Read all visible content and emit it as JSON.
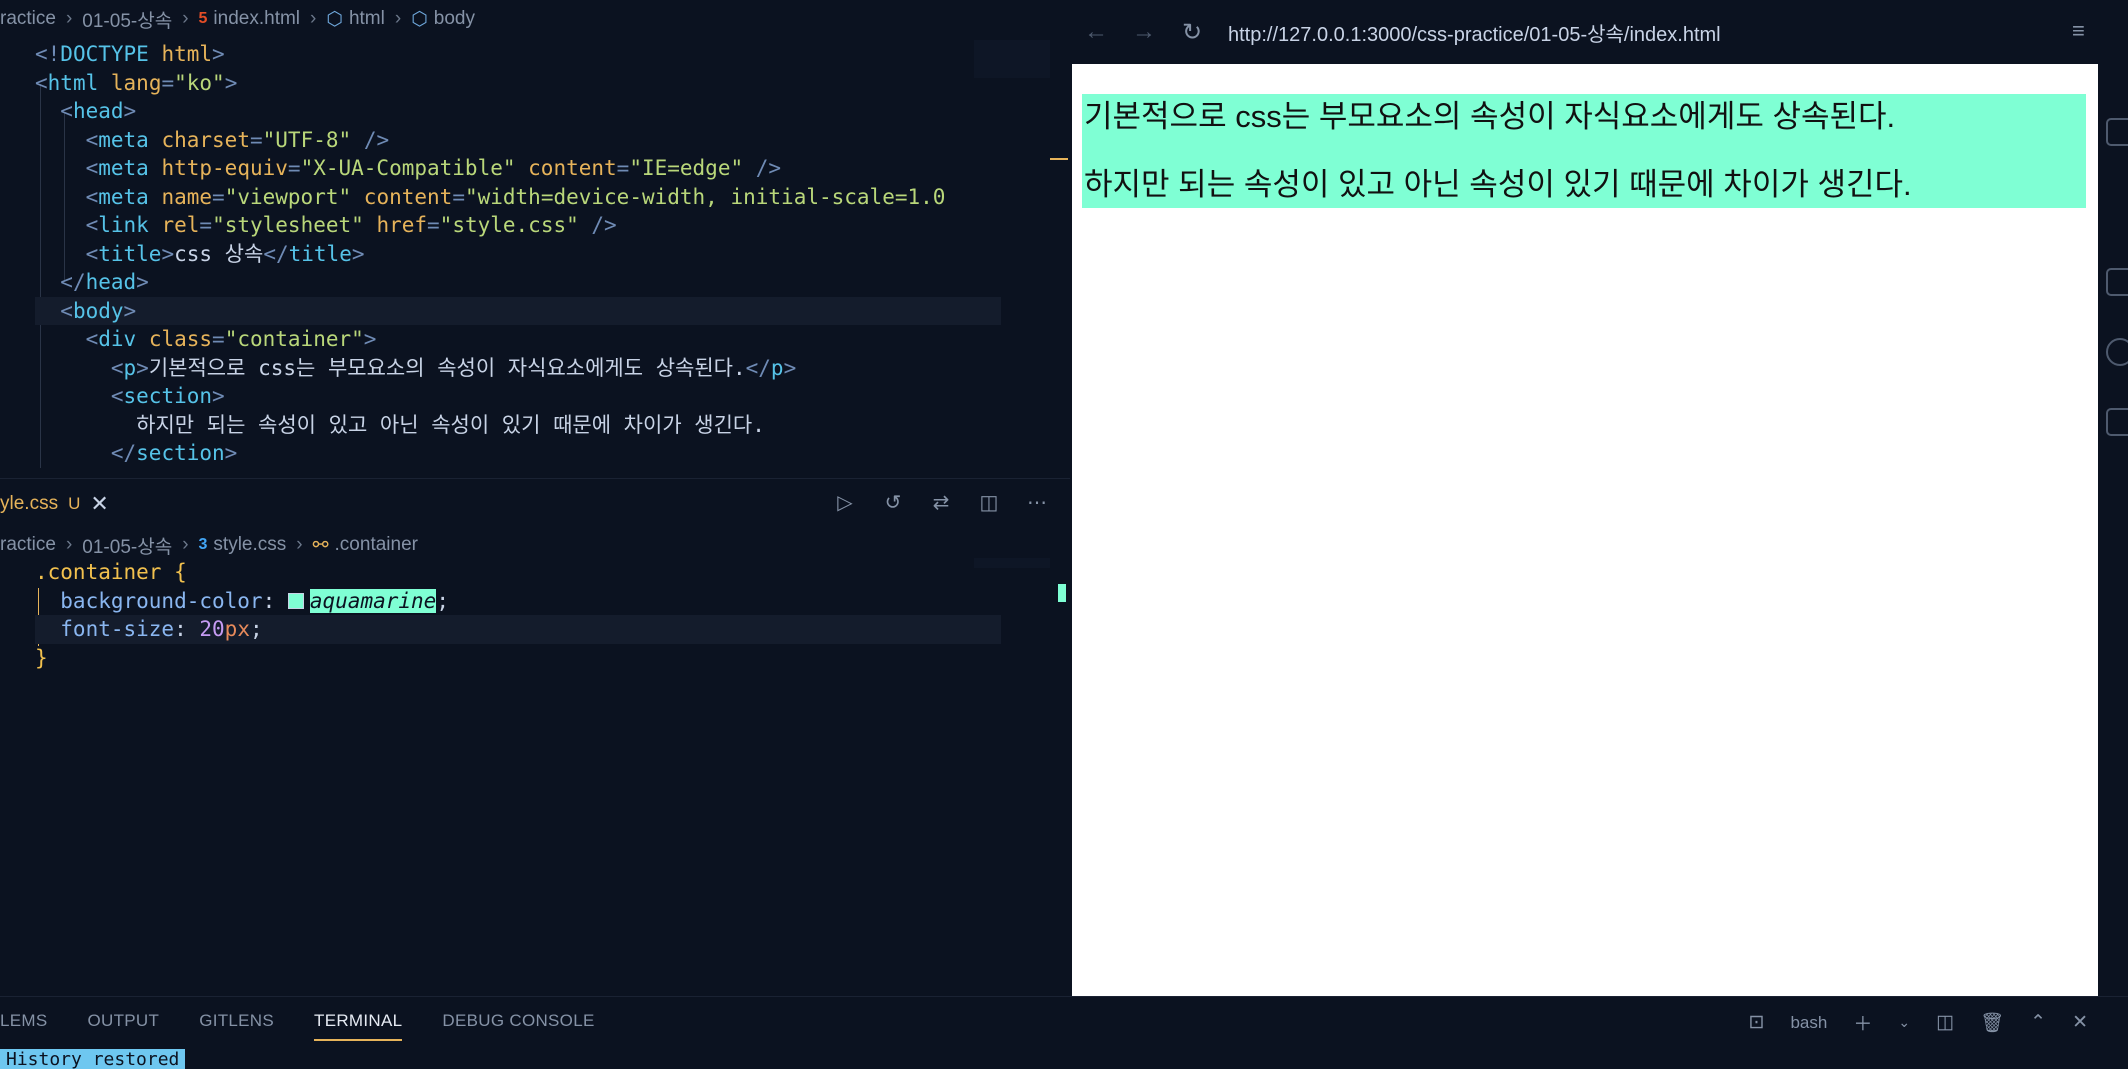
{
  "top_editor": {
    "breadcrumb": [
      "ractice",
      "01-05-상속",
      "index.html",
      "html",
      "body"
    ],
    "lines": [
      [
        [
          "t-punc",
          "<!"
        ],
        [
          "t-tag",
          "DOCTYPE"
        ],
        [
          "t-txt",
          " "
        ],
        [
          "t-attr",
          "html"
        ],
        [
          "t-punc",
          ">"
        ]
      ],
      [
        [
          "t-punc",
          "<"
        ],
        [
          "t-tag",
          "html"
        ],
        [
          "t-txt",
          " "
        ],
        [
          "t-attr",
          "lang"
        ],
        [
          "t-punc",
          "="
        ],
        [
          "t-str",
          "\"ko\""
        ],
        [
          "t-punc",
          ">"
        ]
      ],
      [
        [
          "t-txt",
          "  "
        ],
        [
          "t-punc",
          "<"
        ],
        [
          "t-tag",
          "head"
        ],
        [
          "t-punc",
          ">"
        ]
      ],
      [
        [
          "t-txt",
          "    "
        ],
        [
          "t-punc",
          "<"
        ],
        [
          "t-tag",
          "meta"
        ],
        [
          "t-txt",
          " "
        ],
        [
          "t-attr",
          "charset"
        ],
        [
          "t-punc",
          "="
        ],
        [
          "t-str",
          "\"UTF-8\""
        ],
        [
          "t-txt",
          " "
        ],
        [
          "t-punc",
          "/>"
        ]
      ],
      [
        [
          "t-txt",
          "    "
        ],
        [
          "t-punc",
          "<"
        ],
        [
          "t-tag",
          "meta"
        ],
        [
          "t-txt",
          " "
        ],
        [
          "t-attr",
          "http-equiv"
        ],
        [
          "t-punc",
          "="
        ],
        [
          "t-str",
          "\"X-UA-Compatible\""
        ],
        [
          "t-txt",
          " "
        ],
        [
          "t-attr",
          "content"
        ],
        [
          "t-punc",
          "="
        ],
        [
          "t-str",
          "\"IE=edge\""
        ],
        [
          "t-txt",
          " "
        ],
        [
          "t-punc",
          "/>"
        ]
      ],
      [
        [
          "t-txt",
          "    "
        ],
        [
          "t-punc",
          "<"
        ],
        [
          "t-tag",
          "meta"
        ],
        [
          "t-txt",
          " "
        ],
        [
          "t-attr",
          "name"
        ],
        [
          "t-punc",
          "="
        ],
        [
          "t-str",
          "\"viewport\""
        ],
        [
          "t-txt",
          " "
        ],
        [
          "t-attr",
          "content"
        ],
        [
          "t-punc",
          "="
        ],
        [
          "t-str",
          "\"width=device-width, initial-scale=1.0"
        ]
      ],
      [
        [
          "t-txt",
          "    "
        ],
        [
          "t-punc",
          "<"
        ],
        [
          "t-tag",
          "link"
        ],
        [
          "t-txt",
          " "
        ],
        [
          "t-attr",
          "rel"
        ],
        [
          "t-punc",
          "="
        ],
        [
          "t-str",
          "\"stylesheet\""
        ],
        [
          "t-txt",
          " "
        ],
        [
          "t-attr",
          "href"
        ],
        [
          "t-punc",
          "="
        ],
        [
          "t-str",
          "\"style.css\""
        ],
        [
          "t-txt",
          " "
        ],
        [
          "t-punc",
          "/>"
        ]
      ],
      [
        [
          "t-txt",
          "    "
        ],
        [
          "t-punc",
          "<"
        ],
        [
          "t-tag",
          "title"
        ],
        [
          "t-punc",
          ">"
        ],
        [
          "t-txt",
          "css 상속"
        ],
        [
          "t-punc",
          "</"
        ],
        [
          "t-tag",
          "title"
        ],
        [
          "t-punc",
          ">"
        ]
      ],
      [
        [
          "t-txt",
          "  "
        ],
        [
          "t-punc",
          "</"
        ],
        [
          "t-tag",
          "head"
        ],
        [
          "t-punc",
          ">"
        ]
      ],
      [
        [
          "t-txt",
          "  "
        ],
        [
          "t-punc",
          "<"
        ],
        [
          "t-tag",
          "body"
        ],
        [
          "t-punc",
          ">"
        ]
      ],
      [
        [
          "t-txt",
          "    "
        ],
        [
          "t-punc",
          "<"
        ],
        [
          "t-tag",
          "div"
        ],
        [
          "t-txt",
          " "
        ],
        [
          "t-attr",
          "class"
        ],
        [
          "t-punc",
          "="
        ],
        [
          "t-str",
          "\"container\""
        ],
        [
          "t-punc",
          ">"
        ]
      ],
      [
        [
          "t-txt",
          "      "
        ],
        [
          "t-punc",
          "<"
        ],
        [
          "t-tag",
          "p"
        ],
        [
          "t-punc",
          ">"
        ],
        [
          "t-txt",
          "기본적으로 css는 부모요소의 속성이 자식요소에게도 상속된다."
        ],
        [
          "t-punc",
          "</"
        ],
        [
          "t-tag",
          "p"
        ],
        [
          "t-punc",
          ">"
        ]
      ],
      [
        [
          "t-txt",
          "      "
        ],
        [
          "t-punc",
          "<"
        ],
        [
          "t-tag",
          "section"
        ],
        [
          "t-punc",
          ">"
        ]
      ],
      [
        [
          "t-txt",
          "        하지만 되는 속성이 있고 아닌 속성이 있기 때문에 차이가 생긴다."
        ]
      ],
      [
        [
          "t-txt",
          "      "
        ],
        [
          "t-punc",
          "</"
        ],
        [
          "t-tag",
          "section"
        ],
        [
          "t-punc",
          ">"
        ]
      ]
    ]
  },
  "split_tab": {
    "filename": "yle.css",
    "status": "U"
  },
  "bottom_editor": {
    "breadcrumb": [
      "ractice",
      "01-05-상속",
      "style.css",
      ".container"
    ],
    "lines": [
      [
        [
          "t-sel",
          ".container"
        ],
        [
          "t-txt",
          " "
        ],
        [
          "t-sel",
          "{"
        ]
      ],
      [
        [
          "t-prop",
          "  background-color"
        ],
        [
          "t-txt",
          ": "
        ],
        [
          "swatch",
          ""
        ],
        [
          "t-hl",
          "aquamarine"
        ],
        [
          "t-txt",
          ";"
        ]
      ],
      [
        [
          "t-prop",
          "  font-size"
        ],
        [
          "t-txt",
          ": "
        ],
        [
          "t-num",
          "20"
        ],
        [
          "t-unit",
          "px"
        ],
        [
          "t-txt",
          ";"
        ]
      ],
      [
        [
          "t-sel",
          "}"
        ]
      ]
    ]
  },
  "browser": {
    "url": "http://127.0.0.1:3000/css-practice/01-05-상속/index.html",
    "paragraph": "기본적으로 css는 부모요소의 속성이 자식요소에게도 상속된다.",
    "section": "하지만 되는 속성이 있고 아닌 속성이 있기 때문에 차이가 생긴다.",
    "container_color": "#7fffd4"
  },
  "panel": {
    "tabs": [
      "LEMS",
      "OUTPUT",
      "GITLENS",
      "TERMINAL",
      "DEBUG CONSOLE"
    ],
    "active_tab": "TERMINAL",
    "shell": "bash",
    "terminal_line": "History restored"
  }
}
